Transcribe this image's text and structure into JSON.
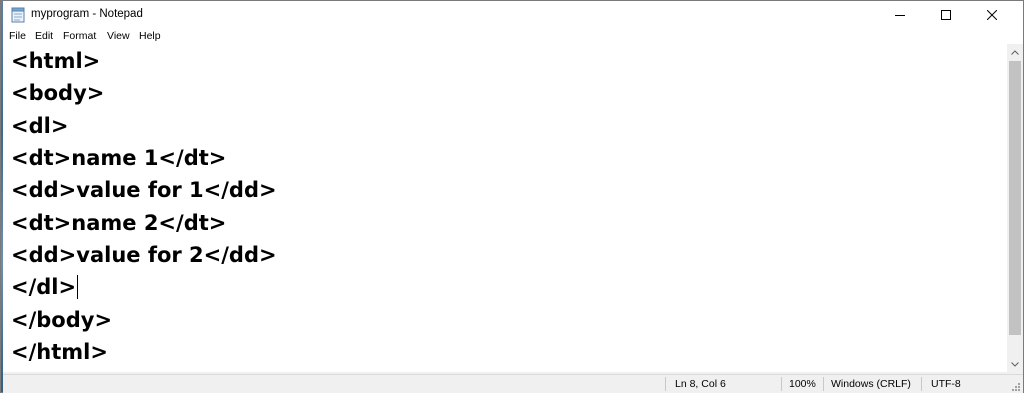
{
  "window": {
    "title": "myprogram - Notepad"
  },
  "menu": {
    "items": [
      "File",
      "Edit",
      "Format",
      "View",
      "Help"
    ]
  },
  "editor": {
    "lines": [
      "<html>",
      "<body>",
      "<dl>",
      "<dt>name 1</dt>",
      "<dd>value for 1</dd>",
      "<dt>name 2</dt>",
      "<dd>value for 2</dd>",
      "</dl>",
      "</body>",
      "</html>"
    ],
    "caret_line": 8,
    "caret_col": 6
  },
  "status": {
    "position": "Ln 8, Col 6",
    "zoom": "100%",
    "line_ending": "Windows (CRLF)",
    "encoding": "UTF-8"
  },
  "icons": {
    "app": "notepad-icon",
    "minimize": "minimize-icon",
    "maximize": "maximize-icon",
    "close": "close-icon",
    "scroll_up": "chevron-up-icon",
    "scroll_down": "chevron-down-icon",
    "resize": "resize-grip-icon"
  },
  "colors": {
    "window_border": "#7a7a7a",
    "status_bg": "#f0f0f0",
    "scroll_thumb": "#c2c2c2"
  }
}
